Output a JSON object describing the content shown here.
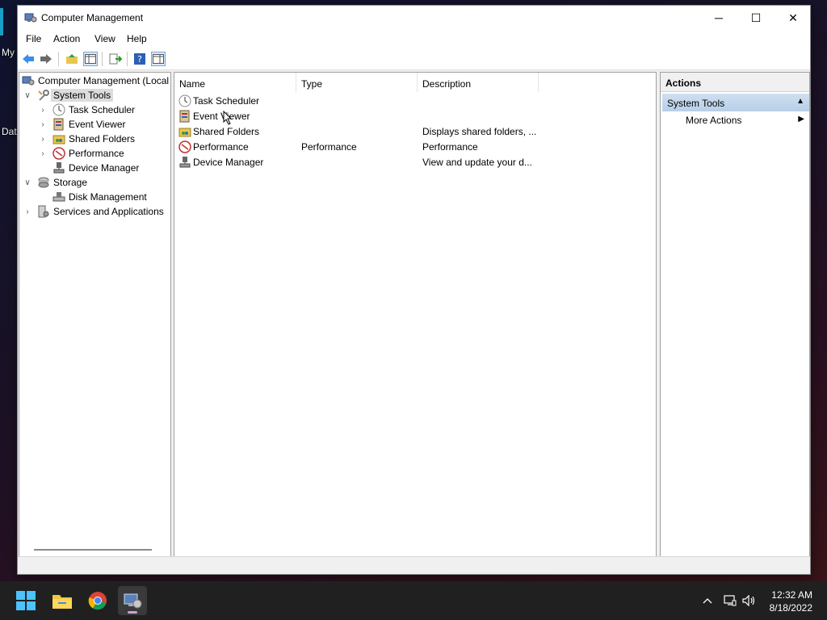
{
  "window": {
    "title": "Computer Management",
    "minimize_label": "─",
    "maximize_label": "☐",
    "close_label": "✕"
  },
  "menu": [
    "File",
    "Action",
    "View",
    "Help"
  ],
  "tree": [
    {
      "label": "Computer Management (Local",
      "chevron": "",
      "icon": "computer-management-icon"
    },
    {
      "label": "System Tools",
      "chevron": "∨",
      "icon": "system-tools-icon",
      "selected": true
    },
    {
      "label": "Task Scheduler",
      "chevron": "›",
      "icon": "clock-icon"
    },
    {
      "label": "Event Viewer",
      "chevron": "›",
      "icon": "event-viewer-icon"
    },
    {
      "label": "Shared Folders",
      "chevron": "›",
      "icon": "shared-folders-icon"
    },
    {
      "label": "Performance",
      "chevron": "›",
      "icon": "performance-icon"
    },
    {
      "label": "Device Manager",
      "chevron": "",
      "icon": "device-manager-icon"
    },
    {
      "label": "Storage",
      "chevron": "∨",
      "icon": "storage-icon"
    },
    {
      "label": "Disk Management",
      "chevron": "",
      "icon": "disk-management-icon"
    },
    {
      "label": "Services and Applications",
      "chevron": "›",
      "icon": "services-icon"
    }
  ],
  "list": {
    "columns": [
      "Name",
      "Type",
      "Description"
    ],
    "rows": [
      {
        "name": "Task Scheduler",
        "type": "",
        "description": "",
        "icon": "clock-icon"
      },
      {
        "name": "Event Viewer",
        "type": "",
        "description": "",
        "icon": "event-viewer-icon"
      },
      {
        "name": "Shared Folders",
        "type": "",
        "description": "Displays shared folders, ...",
        "icon": "shared-folders-icon"
      },
      {
        "name": "Performance",
        "type": "Performance",
        "description": "Performance",
        "icon": "performance-icon"
      },
      {
        "name": "Device Manager",
        "type": "",
        "description": "View and update your d...",
        "icon": "device-manager-icon"
      }
    ]
  },
  "actions": {
    "header": "Actions",
    "section": "System Tools",
    "section_toggle": "▲",
    "item": "More Actions",
    "item_arrow": "▶"
  },
  "desktop": {
    "icon1_label": "My",
    "icon2_label": "Dat"
  },
  "taskbar": {
    "time": "12:32 AM",
    "date": "8/18/2022"
  },
  "colors": {
    "selection": "#dcdcdc",
    "actions_section": "#b7cfe8",
    "taskbar": "#202020"
  }
}
